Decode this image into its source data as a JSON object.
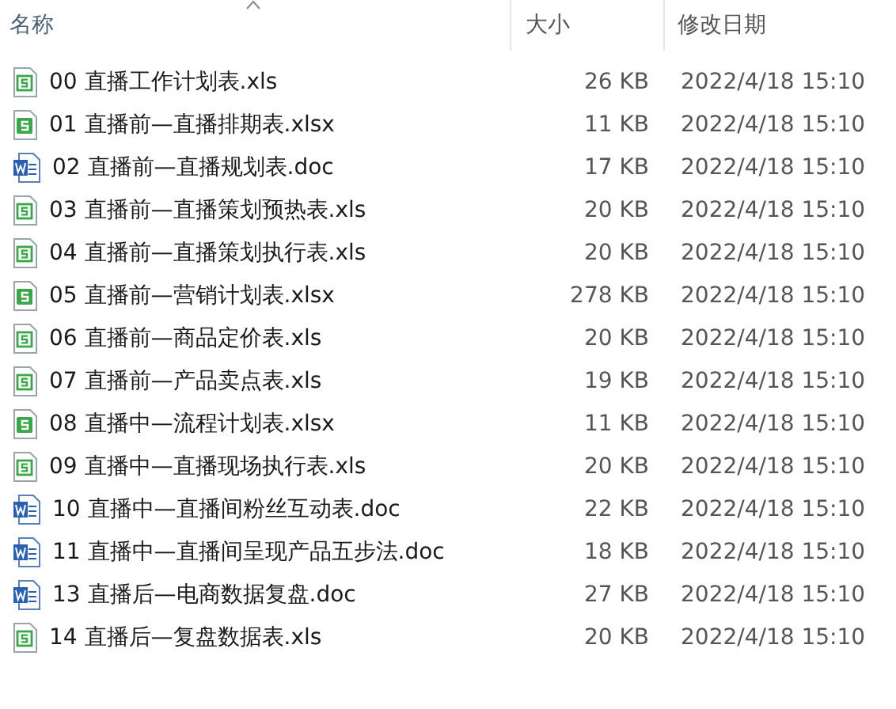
{
  "columns": [
    {
      "label": "名称",
      "sorted": true
    },
    {
      "label": "大小",
      "sorted": false
    },
    {
      "label": "修改日期",
      "sorted": false
    }
  ],
  "files": [
    {
      "name": "00 直播工作计划表.xls",
      "kind": "xls",
      "size": "26 KB",
      "modified": "2022/4/18 15:10"
    },
    {
      "name": "01 直播前—直播排期表.xlsx",
      "kind": "xlsx",
      "size": "11 KB",
      "modified": "2022/4/18 15:10"
    },
    {
      "name": "02 直播前—直播规划表.doc",
      "kind": "doc",
      "size": "17 KB",
      "modified": "2022/4/18 15:10"
    },
    {
      "name": "03 直播前—直播策划预热表.xls",
      "kind": "xls",
      "size": "20 KB",
      "modified": "2022/4/18 15:10"
    },
    {
      "name": "04 直播前—直播策划执行表.xls",
      "kind": "xls",
      "size": "20 KB",
      "modified": "2022/4/18 15:10"
    },
    {
      "name": "05 直播前—营销计划表.xlsx",
      "kind": "xlsx",
      "size": "278 KB",
      "modified": "2022/4/18 15:10"
    },
    {
      "name": "06 直播前—商品定价表.xls",
      "kind": "xls",
      "size": "20 KB",
      "modified": "2022/4/18 15:10"
    },
    {
      "name": "07 直播前—产品卖点表.xls",
      "kind": "xls",
      "size": "19 KB",
      "modified": "2022/4/18 15:10"
    },
    {
      "name": "08 直播中—流程计划表.xlsx",
      "kind": "xlsx",
      "size": "11 KB",
      "modified": "2022/4/18 15:10"
    },
    {
      "name": "09 直播中—直播现场执行表.xls",
      "kind": "xls",
      "size": "20 KB",
      "modified": "2022/4/18 15:10"
    },
    {
      "name": "10 直播中—直播间粉丝互动表.doc",
      "kind": "doc",
      "size": "22 KB",
      "modified": "2022/4/18 15:10"
    },
    {
      "name": "11 直播中—直播间呈现产品五步法.doc",
      "kind": "doc",
      "size": "18 KB",
      "modified": "2022/4/18 15:10"
    },
    {
      "name": "13 直播后—电商数据复盘.doc",
      "kind": "doc",
      "size": "27 KB",
      "modified": "2022/4/18 15:10"
    },
    {
      "name": "14 直播后—复盘数据表.xls",
      "kind": "xls",
      "size": "20 KB",
      "modified": "2022/4/18 15:10"
    }
  ]
}
